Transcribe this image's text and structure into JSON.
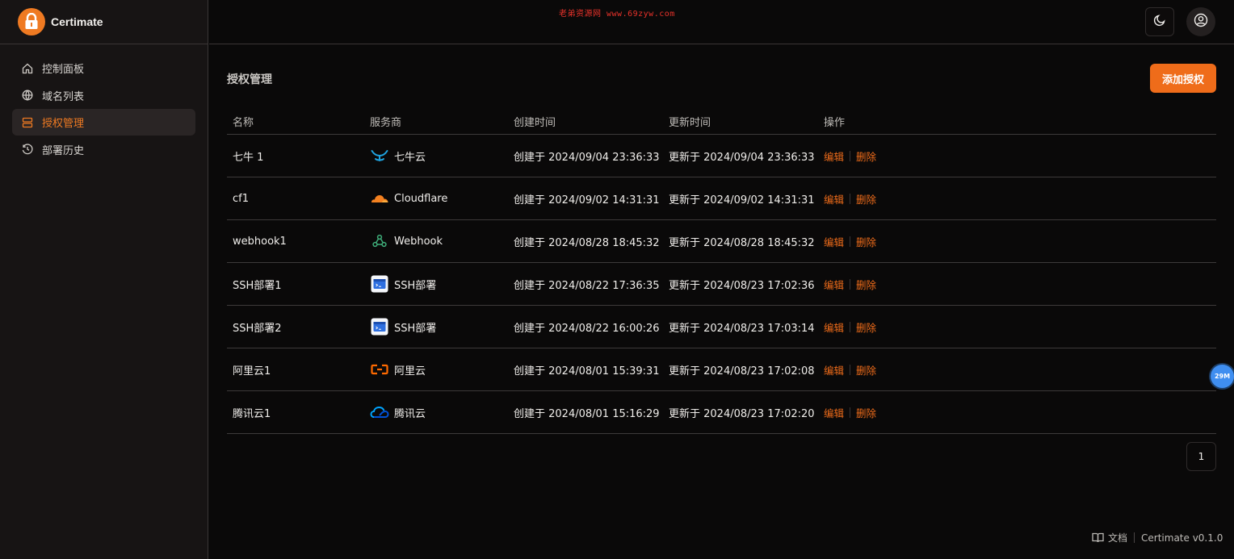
{
  "brand": {
    "name": "Certimate"
  },
  "watermark": "老弟资源网 www.69zyw.com",
  "sidebar": {
    "items": [
      {
        "label": "控制面板",
        "icon": "home-icon",
        "active": false
      },
      {
        "label": "域名列表",
        "icon": "globe-icon",
        "active": false
      },
      {
        "label": "授权管理",
        "icon": "server-icon",
        "active": true
      },
      {
        "label": "部署历史",
        "icon": "history-icon",
        "active": false
      }
    ]
  },
  "header": {
    "theme_icon": "moon-icon",
    "user_icon": "user-circle-icon"
  },
  "page": {
    "title": "授权管理",
    "add_button": "添加授权"
  },
  "table": {
    "columns": [
      "名称",
      "服务商",
      "创建时间",
      "更新时间",
      "操作"
    ],
    "rows": [
      {
        "name": "七牛 1",
        "provider": "七牛云",
        "provider_icon": "qiniu-icon",
        "created": "创建于 2024/09/04 23:36:33",
        "updated": "更新于 2024/09/04 23:36:33",
        "edit": "编辑",
        "delete": "删除"
      },
      {
        "name": "cf1",
        "provider": "Cloudflare",
        "provider_icon": "cloudflare-icon",
        "created": "创建于 2024/09/02 14:31:31",
        "updated": "更新于 2024/09/02 14:31:31",
        "edit": "编辑",
        "delete": "删除"
      },
      {
        "name": "webhook1",
        "provider": "Webhook",
        "provider_icon": "webhook-icon",
        "created": "创建于 2024/08/28 18:45:32",
        "updated": "更新于 2024/08/28 18:45:32",
        "edit": "编辑",
        "delete": "删除"
      },
      {
        "name": "SSH部署1",
        "provider": "SSH部署",
        "provider_icon": "ssh-icon",
        "created": "创建于 2024/08/22 17:36:35",
        "updated": "更新于 2024/08/23 17:02:36",
        "edit": "编辑",
        "delete": "删除"
      },
      {
        "name": "SSH部署2",
        "provider": "SSH部署",
        "provider_icon": "ssh-icon",
        "created": "创建于 2024/08/22 16:00:26",
        "updated": "更新于 2024/08/23 17:03:14",
        "edit": "编辑",
        "delete": "删除"
      },
      {
        "name": "阿里云1",
        "provider": "阿里云",
        "provider_icon": "aliyun-icon",
        "created": "创建于 2024/08/01 15:39:31",
        "updated": "更新于 2024/08/23 17:02:08",
        "edit": "编辑",
        "delete": "删除"
      },
      {
        "name": "腾讯云1",
        "provider": "腾讯云",
        "provider_icon": "tencent-cloud-icon",
        "created": "创建于 2024/08/01 15:16:29",
        "updated": "更新于 2024/08/23 17:02:20",
        "edit": "编辑",
        "delete": "删除"
      }
    ]
  },
  "pagination": {
    "current": "1"
  },
  "floating_badge": "29M",
  "footer": {
    "docs": "文档",
    "version": "Certimate v0.1.0"
  },
  "colors": {
    "accent": "#ef6c1a",
    "background": "#0a0909",
    "sidebar": "#171414"
  }
}
